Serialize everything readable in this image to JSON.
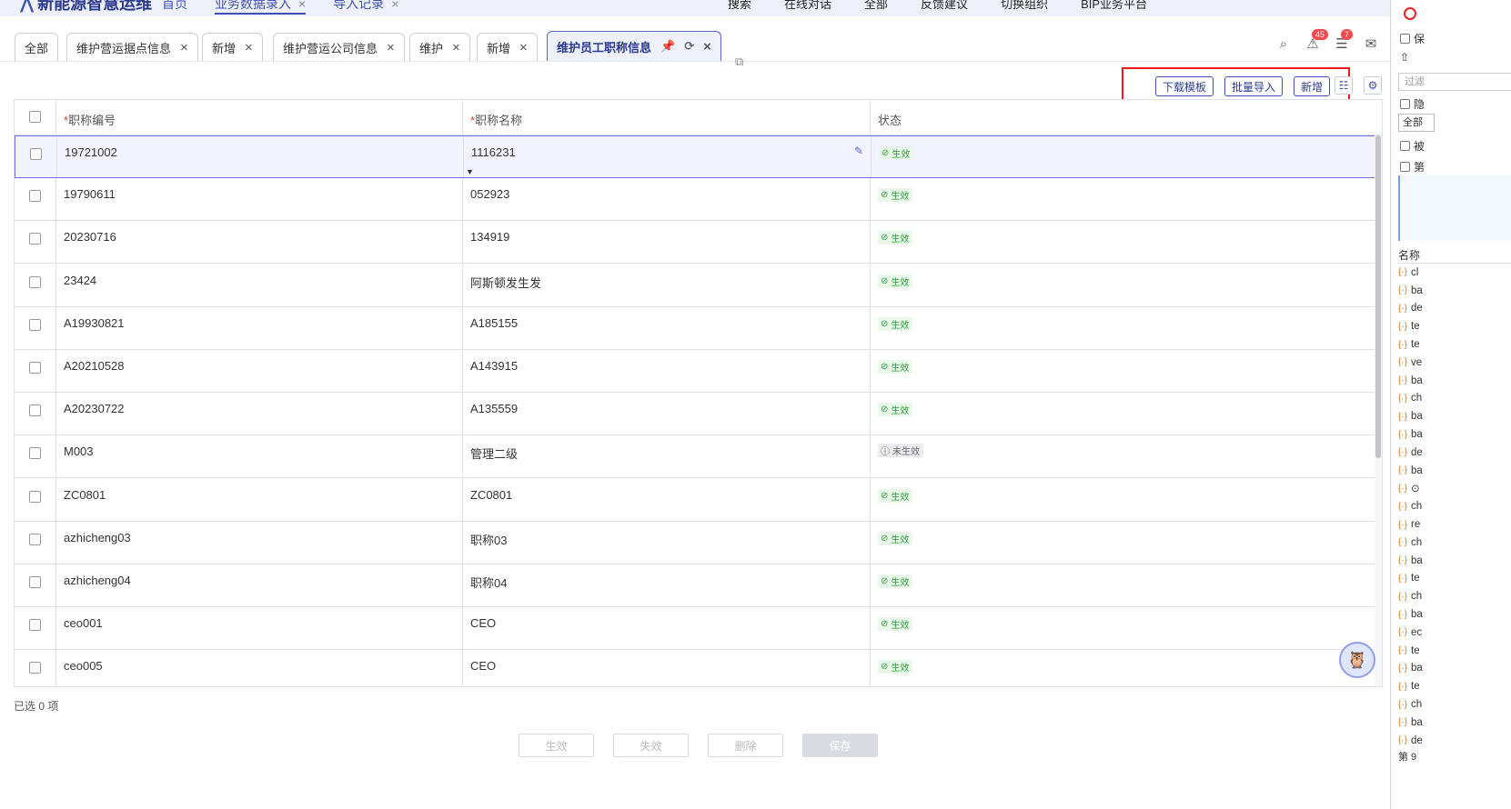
{
  "topbar": {
    "logo": "新能源智慧运维",
    "nav": [
      {
        "label": "首页",
        "closable": false
      },
      {
        "label": "业务数据录入",
        "closable": true,
        "active": true
      },
      {
        "label": "导入记录",
        "closable": true
      }
    ],
    "right": [
      "搜索",
      "在线对话",
      "全部",
      "反馈建议",
      "切换组织",
      "BIP业务平台"
    ]
  },
  "tabs": [
    {
      "label": "全部",
      "closable": false
    },
    {
      "label": "维护营运据点信息",
      "closable": true
    },
    {
      "label": "新增",
      "closable": true
    },
    {
      "label": "维护营运公司信息",
      "closable": true
    },
    {
      "label": "维护",
      "closable": true
    },
    {
      "label": "新增",
      "closable": true
    },
    {
      "label": "维护员工职称信息",
      "closable": true,
      "active": true
    }
  ],
  "header_badges": {
    "notifications": "45",
    "tasks": "7"
  },
  "toolbar": {
    "download_template": "下载模板",
    "batch_import": "批量导入",
    "add_new": "新增"
  },
  "table": {
    "columns": [
      {
        "label": "职称编号",
        "required": true
      },
      {
        "label": "职称名称",
        "required": true
      },
      {
        "label": "状态",
        "required": false
      }
    ],
    "rows": [
      {
        "code": "19721002",
        "name": "1116231",
        "status": "生效",
        "active": true
      },
      {
        "code": "19790611",
        "name": "052923",
        "status": "生效",
        "active": true
      },
      {
        "code": "20230716",
        "name": "134919",
        "status": "生效",
        "active": true
      },
      {
        "code": "23424",
        "name": "阿斯顿发生发",
        "status": "生效",
        "active": true
      },
      {
        "code": "A19930821",
        "name": "A185155",
        "status": "生效",
        "active": true
      },
      {
        "code": "A20210528",
        "name": "A143915",
        "status": "生效",
        "active": true
      },
      {
        "code": "A20230722",
        "name": "A135559",
        "status": "生效",
        "active": true
      },
      {
        "code": "M003",
        "name": "管理二级",
        "status": "未生效",
        "active": false
      },
      {
        "code": "ZC0801",
        "name": "ZC0801",
        "status": "生效",
        "active": true
      },
      {
        "code": "azhicheng03",
        "name": "职称03",
        "status": "生效",
        "active": true
      },
      {
        "code": "azhicheng04",
        "name": "职称04",
        "status": "生效",
        "active": true
      },
      {
        "code": "ceo001",
        "name": "CEO",
        "status": "生效",
        "active": true
      },
      {
        "code": "ceo005",
        "name": "CEO",
        "status": "生效",
        "active": true
      }
    ]
  },
  "footer": {
    "selected_info": "已选 0 项",
    "buttons": {
      "activate": "生效",
      "deactivate": "失效",
      "delete": "删除",
      "save": "保存"
    }
  },
  "devtools": {
    "filter_placeholder": "过滤",
    "type_select": "全部",
    "column_name": "名称",
    "items": [
      "cl",
      "ba",
      "de",
      "te",
      "te",
      "ve",
      "ba",
      "ch",
      "ba",
      "ba",
      "de",
      "ba",
      "⊙",
      "ch",
      "re",
      "ch",
      "ba",
      "te",
      "ch",
      "ba",
      "ec",
      "te",
      "ba",
      "te",
      "ch",
      "ba",
      "de"
    ],
    "footer": "第 9"
  },
  "colors": {
    "accent": "#3f51b5",
    "ok": "#2e9d3b",
    "highlight": "#f01818"
  }
}
